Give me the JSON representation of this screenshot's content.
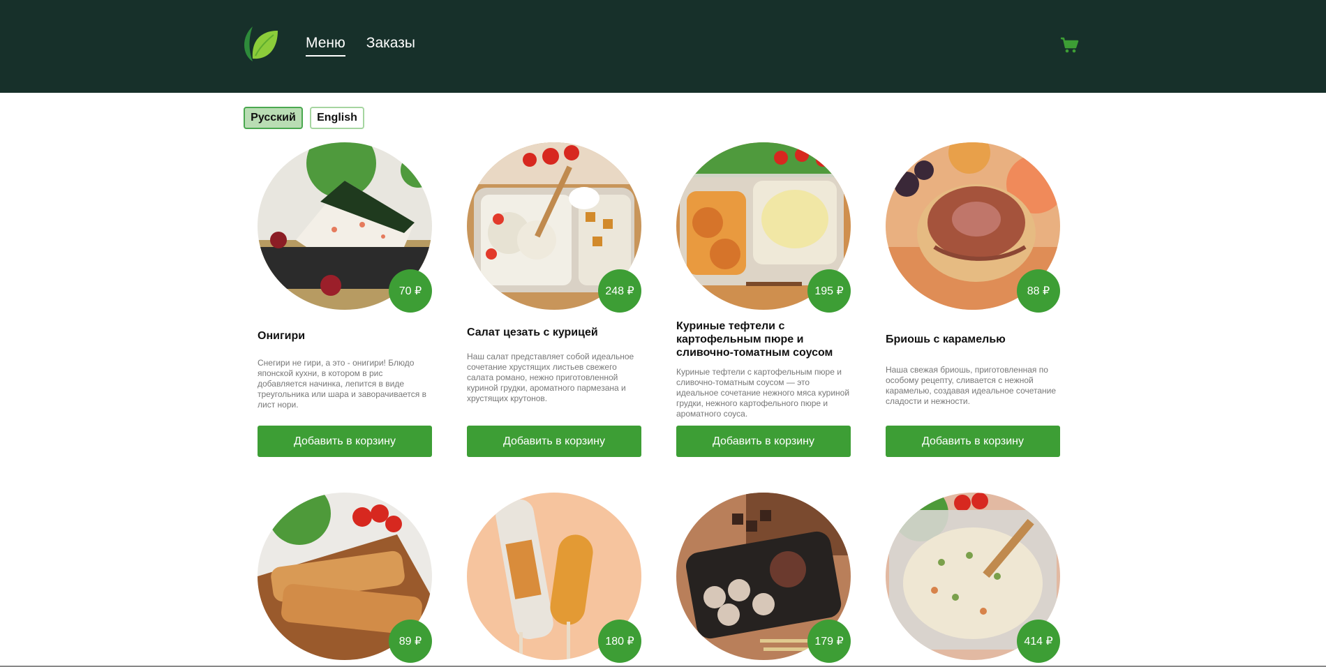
{
  "nav": {
    "menu_label": "Меню",
    "orders_label": "Заказы"
  },
  "languages": {
    "russian": "Русский",
    "english": "English",
    "selected": "Русский"
  },
  "colors": {
    "header_bg": "#17302a",
    "accent_green": "#3d9e35",
    "language_selected_bg": "#b9ddb4"
  },
  "products": [
    {
      "title": "Онигири",
      "price": "70 ₽",
      "description": "Снегири не гири, а это - онигири! Блюдо японской кухни, в котором в рис добавляется начинка, лепится в виде треугольника или шара и заворачивается в лист нори.",
      "button": "Добавить в корзину"
    },
    {
      "title": "Салат цезать с курицей",
      "price": "248 ₽",
      "description": "Наш салат представляет собой идеальное сочетание хрустящих листьев свежего салата романо, нежно приготовленной куриной грудки, ароматного пармезана и хрустящих крутонов.",
      "button": "Добавить в корзину"
    },
    {
      "title": "Куриные тефтели с картофельным пюре и сливочно-томатным соусом",
      "price": "195 ₽",
      "description": "Куриные тефтели с картофельным пюре и сливочно-томатным соусом — это идеальное сочетание нежного мяса куриной грудки, нежного картофельного пюре и ароматного соуса.",
      "button": "Добавить в корзину"
    },
    {
      "title": "Бриошь с карамелью",
      "price": "88 ₽",
      "description": "Наша свежая бриошь, приготовленная по особому рецепту, сливается с нежной карамелью, создавая идеальное сочетание сладости и нежности.",
      "button": "Добавить в корзину"
    },
    {
      "price": "89 ₽"
    },
    {
      "price": "180 ₽"
    },
    {
      "price": "179 ₽"
    },
    {
      "price": "414 ₽"
    }
  ]
}
